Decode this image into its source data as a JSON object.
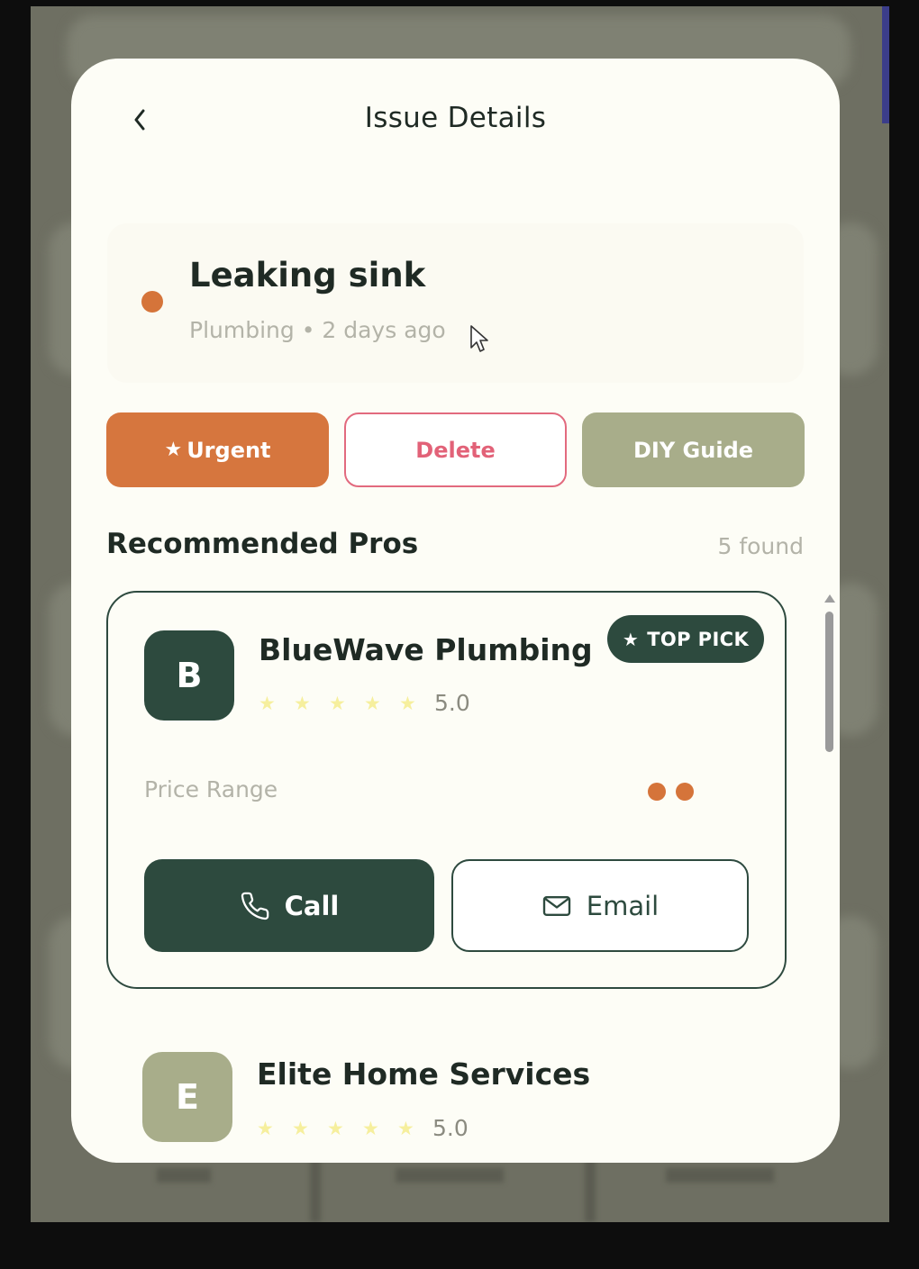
{
  "header": {
    "title": "Issue Details",
    "back_icon": "chevron-left-icon"
  },
  "issue": {
    "title": "Leaking sink",
    "meta": "Plumbing • 2 days ago",
    "status_color": "#d5743a"
  },
  "actions": {
    "urgent_label": "Urgent",
    "delete_label": "Delete",
    "diy_label": "DIY Guide"
  },
  "recommended": {
    "title": "Recommended Pros",
    "count": "5 found",
    "pros": [
      {
        "initial": "B",
        "name": "BlueWave Plumbing",
        "rating": "5.0",
        "stars": 5,
        "badge": "TOP PICK",
        "price_label": "Price Range",
        "price_level": 2,
        "call_label": "Call",
        "email_label": "Email"
      },
      {
        "initial": "E",
        "name": "Elite Home Services",
        "rating": "5.0",
        "stars": 5
      }
    ]
  },
  "colors": {
    "brand_dark": "#2d4a3e",
    "accent_orange": "#d6763e",
    "danger": "#e26278",
    "olive": "#a8ad8a",
    "star": "#f6ef9d"
  }
}
